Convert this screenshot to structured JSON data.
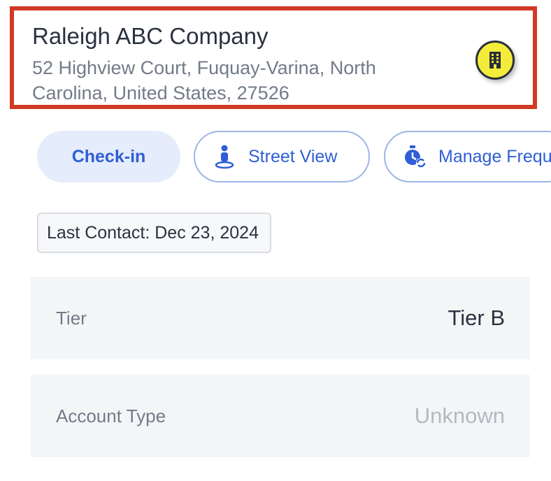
{
  "header": {
    "name": "Raleigh ABC Company",
    "address": "52 Highview Court, Fuquay-Varina, North Carolina, United States, 27526",
    "badge_icon": "building-icon",
    "highlight_color": "#d13a24",
    "badge_color": "#f3ec3a"
  },
  "actions": {
    "checkin_label": "Check-in",
    "street_view_label": "Street View",
    "street_view_icon": "street-view-icon",
    "manage_label": "Manage Frequ",
    "manage_icon": "manage-frequency-icon",
    "accent_color": "#2f5fd4"
  },
  "last_contact": {
    "text": "Last Contact: Dec 23, 2024"
  },
  "details": [
    {
      "label": "Tier",
      "value": "Tier B"
    },
    {
      "label": "Account Type",
      "value": "Unknown"
    }
  ]
}
